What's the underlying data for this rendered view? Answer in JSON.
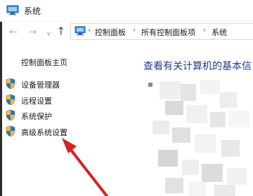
{
  "window": {
    "title": "系统",
    "title_icon": "system-control-panel-icon"
  },
  "nav": {
    "back_icon": "arrow-left-icon",
    "forward_icon": "arrow-right-icon",
    "recent_icon": "chevron-down-icon",
    "up_icon": "arrow-up-icon"
  },
  "address": {
    "icon": "control-panel-icon",
    "crumbs": [
      "控制面板",
      "所有控制面板项",
      "系统"
    ],
    "separator": "›"
  },
  "sidebar": {
    "home_label": "控制面板主页",
    "links": [
      {
        "label": "设备管理器",
        "icon": "shield-icon"
      },
      {
        "label": "远程设置",
        "icon": "shield-icon"
      },
      {
        "label": "系统保护",
        "icon": "shield-icon"
      },
      {
        "label": "高级系统设置",
        "icon": "shield-icon"
      }
    ]
  },
  "main": {
    "heading": "查看有关计算机的基本信"
  },
  "annotation": {
    "arrow_color": "#d42222"
  },
  "colors": {
    "heading": "#1e3d8f",
    "window_bg": "#ffffff"
  }
}
